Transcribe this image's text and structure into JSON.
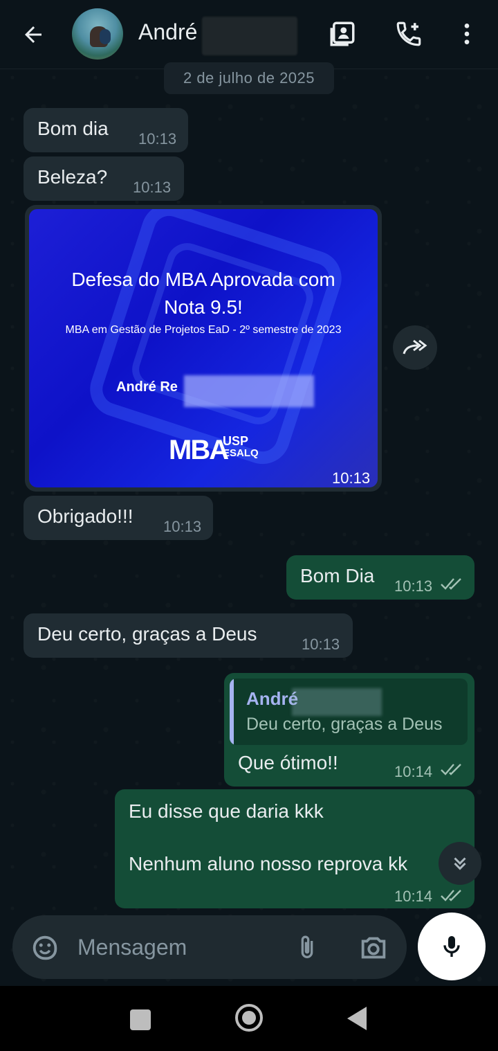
{
  "header": {
    "contact_name": "André",
    "back_icon": "arrow-left-icon",
    "icons": [
      "contact-card-icon",
      "add-call-icon",
      "more-vert-icon"
    ]
  },
  "chat": {
    "date_chip": "2 de julho de 2025",
    "messages": [
      {
        "text": "Bom dia",
        "time": "10:13",
        "direction": "incoming"
      },
      {
        "text": "Beleza?",
        "time": "10:13",
        "direction": "incoming"
      },
      {
        "type": "image",
        "time": "10:13",
        "direction": "incoming",
        "image_title_line1": "Defesa do MBA Aprovada com",
        "image_title_line2": "Nota 9.5!",
        "image_subtitle": "MBA em Gestão de Projetos EaD - 2º semestre de 2023",
        "image_name": "André Re",
        "image_logo": "MBA",
        "image_logo_sub1": "USP",
        "image_logo_sub2": "ESALQ"
      },
      {
        "text": "Obrigado!!!",
        "time": "10:13",
        "direction": "incoming"
      },
      {
        "text": "Bom Dia",
        "time": "10:13",
        "direction": "outgoing",
        "status": "read"
      },
      {
        "text": "Deu certo, graças a Deus",
        "time": "10:13",
        "direction": "incoming"
      },
      {
        "text": "Que ótimo!!",
        "time": "10:14",
        "direction": "outgoing",
        "status": "read",
        "reply_author": "André",
        "reply_text": "Deu certo, graças a Deus"
      },
      {
        "line1": "Eu disse que daria kkk",
        "line2": "Nenhum aluno nosso reprova kk",
        "time": "10:14",
        "direction": "outgoing",
        "status": "read"
      }
    ]
  },
  "composer": {
    "placeholder": "Mensagem",
    "icons": [
      "sticker-icon",
      "paperclip-icon",
      "camera-icon",
      "microphone-icon"
    ]
  },
  "colors": {
    "background": "#0b141a",
    "incoming_bubble": "#202c33",
    "outgoing_bubble": "#144d37",
    "accent_quote": "#a5b3f0"
  }
}
